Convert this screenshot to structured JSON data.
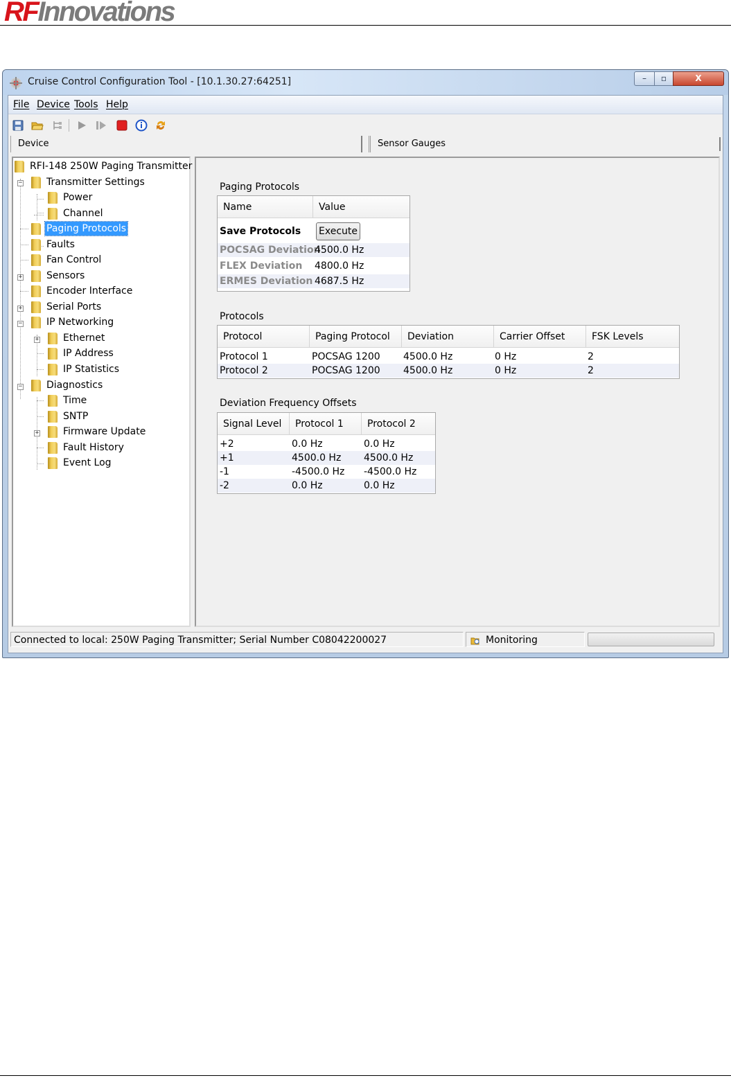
{
  "brand": {
    "logo_rf": "RF",
    "logo_rest": "Innovations"
  },
  "window": {
    "title": "Cruise Control Configuration Tool - [10.1.30.27:64251]",
    "controls": {
      "minimize": "–",
      "maximize": "▫",
      "close": "X"
    }
  },
  "menu": [
    "File",
    "Device",
    "Tools",
    "Help"
  ],
  "toolbar": [
    "save-icon",
    "open-folder-icon",
    "tree-icon",
    "play-icon",
    "step-icon",
    "stop-icon",
    "info-icon",
    "refresh-icon"
  ],
  "panes": {
    "left": "Device",
    "right": "Sensor Gauges"
  },
  "tree": [
    {
      "label": "RFI-148 250W Paging Transmitter"
    },
    {
      "label": "Transmitter Settings"
    },
    {
      "label": "Power"
    },
    {
      "label": "Channel"
    },
    {
      "label": "Paging Protocols",
      "selected": true
    },
    {
      "label": "Faults"
    },
    {
      "label": "Fan Control"
    },
    {
      "label": "Sensors"
    },
    {
      "label": "Encoder Interface"
    },
    {
      "label": "Serial Ports"
    },
    {
      "label": "IP Networking"
    },
    {
      "label": "Ethernet"
    },
    {
      "label": "IP Address"
    },
    {
      "label": "IP Statistics"
    },
    {
      "label": "Diagnostics"
    },
    {
      "label": "Time"
    },
    {
      "label": "SNTP"
    },
    {
      "label": "Firmware Update"
    },
    {
      "label": "Fault History"
    },
    {
      "label": "Event Log"
    }
  ],
  "paging_protocols": {
    "title": "Paging Protocols",
    "headers": [
      "Name",
      "Value"
    ],
    "save_label": "Save Protocols",
    "execute_label": "Execute",
    "rows": [
      [
        "POCSAG Deviation",
        "4500.0 Hz"
      ],
      [
        "FLEX Deviation",
        "4800.0 Hz"
      ],
      [
        "ERMES Deviation",
        "4687.5 Hz"
      ]
    ]
  },
  "protocols": {
    "title": "Protocols",
    "headers": [
      "Protocol",
      "Paging Protocol",
      "Deviation",
      "Carrier Offset",
      "FSK Levels"
    ],
    "rows": [
      [
        "Protocol 1",
        "POCSAG 1200",
        "4500.0 Hz",
        "0 Hz",
        "2"
      ],
      [
        "Protocol 2",
        "POCSAG 1200",
        "4500.0 Hz",
        "0 Hz",
        "2"
      ]
    ]
  },
  "deviation_offsets": {
    "title": "Deviation Frequency Offsets",
    "headers": [
      "Signal Level",
      "Protocol 1",
      "Protocol 2"
    ],
    "rows": [
      [
        "+2",
        "0.0 Hz",
        "0.0 Hz"
      ],
      [
        "+1",
        "4500.0 Hz",
        "4500.0 Hz"
      ],
      [
        "-1",
        "-4500.0 Hz",
        "-4500.0 Hz"
      ],
      [
        "-2",
        "0.0 Hz",
        "0.0 Hz"
      ]
    ]
  },
  "status": {
    "connection": "Connected to local: 250W Paging Transmitter; Serial Number C08042200027",
    "mode": "Monitoring"
  }
}
